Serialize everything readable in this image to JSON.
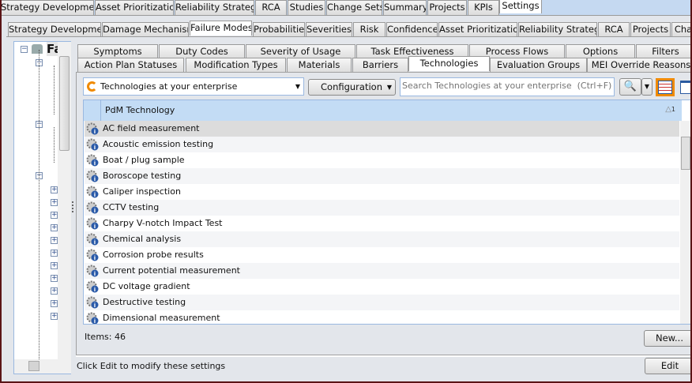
{
  "top_tabs": [
    "Strategy Development",
    "Asset Prioritization",
    "Reliability Strategy",
    "RCA",
    "Studies",
    "Change Sets",
    "Summary",
    "Projects",
    "KPIs",
    "Settings"
  ],
  "settings_tabs": [
    "Strategy Development",
    "Damage Mechanisms",
    "Failure Modes",
    "Probabilities",
    "Severities",
    "Risk",
    "Confidence",
    "Asset Prioritization",
    "Reliability Strategy",
    "RCA",
    "Projects",
    "Cha"
  ],
  "sub_tabs_row1": [
    "Symptoms",
    "Duty Codes",
    "Severity of Usage",
    "Task Effectiveness",
    "Process Flows",
    "Options",
    "Filters"
  ],
  "sub_tabs_row2": [
    "Action Plan Statuses",
    "Modification Types",
    "Materials",
    "Barriers",
    "Technologies",
    "Evaluation Groups",
    "MEI Override Reasons"
  ],
  "tree": {
    "root_label": "Fa"
  },
  "toolbar": {
    "scope": "Technologies at your enterprise",
    "configuration": "Configuration",
    "search_placeholder": "Search Technologies at your enterprise  (Ctrl+F)"
  },
  "grid": {
    "column": "PdM Technology",
    "sort_indicator": "1",
    "rows": [
      "AC field measurement",
      "Acoustic emission testing",
      "Boat / plug sample",
      "Boroscope testing",
      "Caliper inspection",
      "CCTV testing",
      "Charpy V-notch Impact Test",
      "Chemical analysis",
      "Corrosion probe results",
      "Current potential measurement",
      "DC voltage gradient",
      "Destructive testing",
      "Dimensional measurement"
    ]
  },
  "footer": {
    "items": "Items: 46",
    "new_button": "New...",
    "status": "Click Edit to modify these settings",
    "edit_button": "Edit"
  },
  "colors": {
    "accent": "#f08a00",
    "header": "#c3dcf5",
    "selected_row": "#dcdcdc"
  }
}
